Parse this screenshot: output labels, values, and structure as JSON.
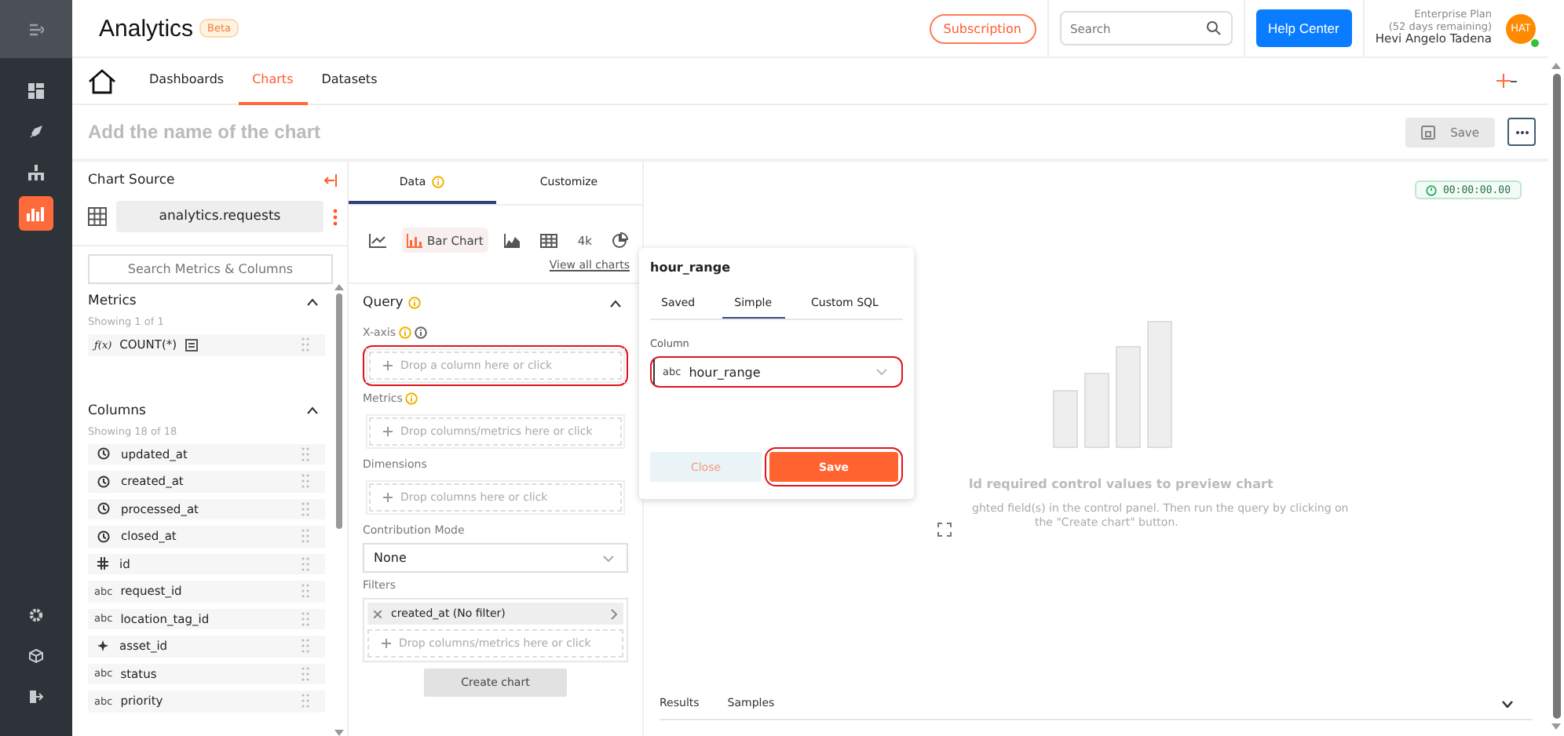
{
  "nav_rail": {
    "items": [
      {
        "selected": false
      },
      {
        "selected": false
      },
      {
        "selected": false
      },
      {
        "selected": true
      }
    ]
  },
  "header": {
    "app_title": "Analytics",
    "badge": "Beta",
    "subscription": "Subscription",
    "search": {
      "placeholder": "Search"
    },
    "help": "Help Center",
    "user": {
      "plan": "Enterprise Plan",
      "remaining": "(52 days remaining)",
      "name": "Hevi Angelo Tadena",
      "avatar": "HAT",
      "online": true
    }
  },
  "tabs": [
    {
      "label": "Dashboards",
      "selected": false
    },
    {
      "label": "Charts",
      "selected": true
    },
    {
      "label": "Datasets",
      "selected": false
    }
  ],
  "title_bar": {
    "placeholder": "Add the name of the chart",
    "save": "Save",
    "save_disabled": true
  },
  "chart_source": {
    "title": "Chart Source",
    "dataset": "analytics.requests",
    "search": {
      "placeholder": "Search Metrics & Columns"
    },
    "metrics": {
      "title": "Metrics",
      "count": "Showing 1 of 1",
      "items": [
        {
          "fx_label": "ƒ(x)",
          "name": "COUNT(*)"
        }
      ]
    },
    "columns": {
      "title": "Columns",
      "count": "Showing 18 of 18",
      "items": [
        {
          "kind": "time",
          "name": "updated_at"
        },
        {
          "kind": "time",
          "name": "created_at"
        },
        {
          "kind": "time",
          "name": "processed_at"
        },
        {
          "kind": "time",
          "name": "closed_at"
        },
        {
          "kind": "number",
          "name": "id"
        },
        {
          "kind": "text",
          "type_label": "abc",
          "name": "request_id"
        },
        {
          "kind": "text",
          "type_label": "abc",
          "name": "location_tag_id"
        },
        {
          "kind": "key",
          "name": "asset_id"
        },
        {
          "kind": "text",
          "type_label": "abc",
          "name": "status"
        },
        {
          "kind": "text",
          "type_label": "abc",
          "name": "priority"
        }
      ]
    }
  },
  "panel_tabs": [
    {
      "label": "Data",
      "selected": true,
      "info": true
    },
    {
      "label": "Customize",
      "selected": false,
      "info": false
    }
  ],
  "chart_types": [
    {
      "kind": "line",
      "selected": false
    },
    {
      "kind": "bar",
      "label": "Bar Chart",
      "selected": true
    },
    {
      "kind": "area",
      "selected": false
    },
    {
      "kind": "table",
      "selected": false
    },
    {
      "kind": "number",
      "label": "4k",
      "selected": false
    },
    {
      "kind": "pie",
      "selected": false
    }
  ],
  "view_all": "View all charts",
  "query": {
    "title": "Query",
    "info": true,
    "expanded": true,
    "fields": [
      {
        "label": "X-axis",
        "info": true,
        "help": true,
        "placeholder": "Drop a column here or click",
        "highlighted": true
      },
      {
        "label": "Metrics",
        "info": true,
        "help": false,
        "placeholder": "Drop columns/metrics here or click",
        "highlighted": false
      },
      {
        "label": "Dimensions",
        "info": false,
        "help": false,
        "placeholder": "Drop columns here or click",
        "highlighted": false
      }
    ],
    "contribution": {
      "label": "Contribution Mode",
      "value": "None"
    },
    "filters": {
      "label": "Filters",
      "chips": [
        {
          "label": "created_at (No filter)"
        }
      ],
      "placeholder": "Drop columns/metrics here or click"
    },
    "create": "Create chart"
  },
  "preview": {
    "timer": "00:00:00.00",
    "message_lines": [
      "ld required control values to preview chart",
      "ghted field(s) in the control panel. Then run the query by clicking on",
      "the \"Create chart\" button."
    ],
    "result_tabs": [
      {
        "label": "Results"
      },
      {
        "label": "Samples"
      }
    ]
  },
  "popover": {
    "title": "hour_range",
    "tabs": [
      {
        "label": "Saved",
        "selected": false
      },
      {
        "label": "Simple",
        "selected": true
      },
      {
        "label": "Custom SQL",
        "selected": false
      }
    ],
    "column_label": "Column",
    "type_label": "abc",
    "value": "hour_range",
    "column_highlighted": true,
    "close": "Close",
    "save": "Save",
    "save_highlighted": true
  }
}
